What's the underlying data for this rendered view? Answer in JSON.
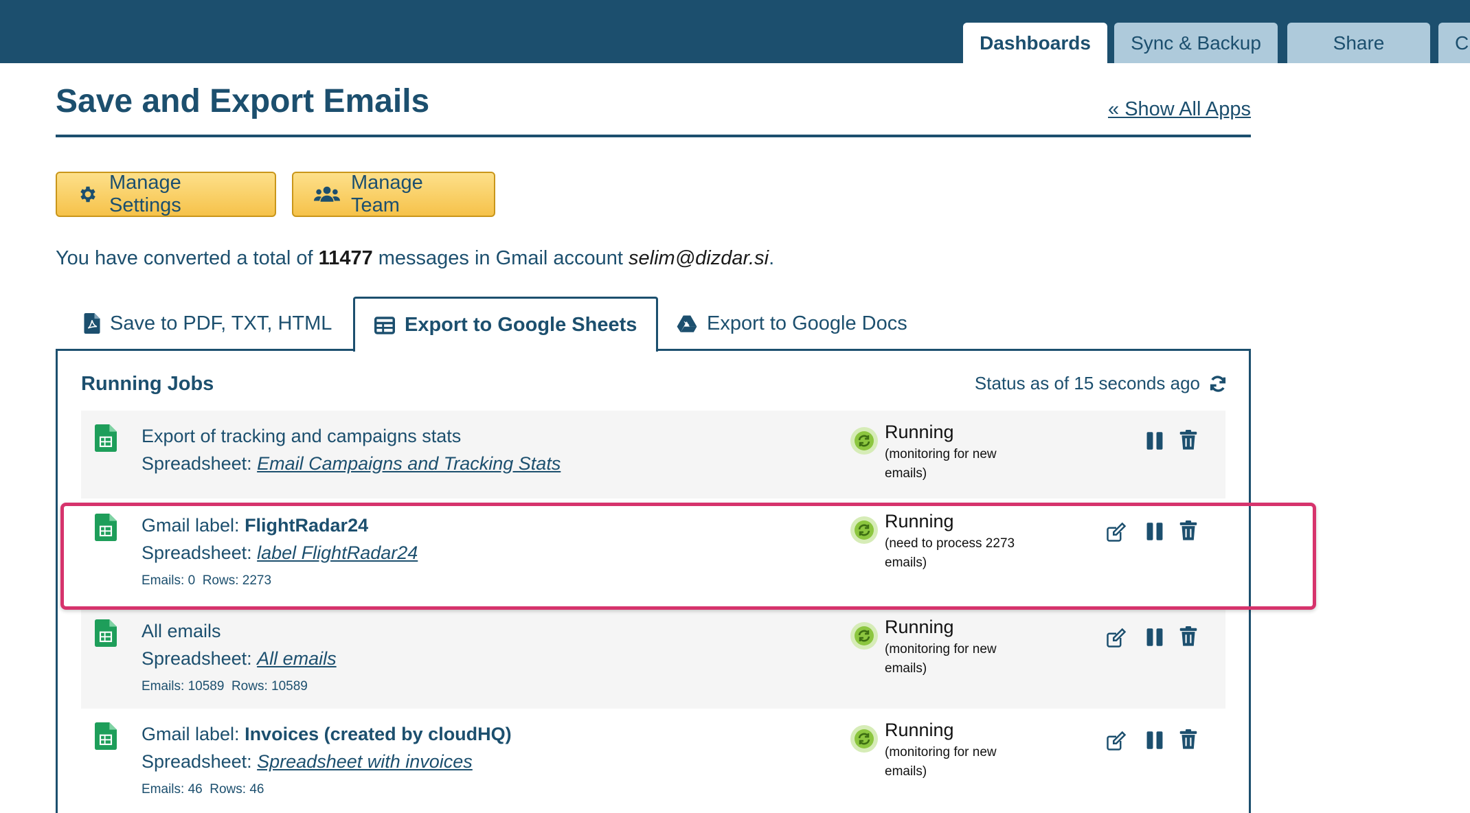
{
  "nav": {
    "tabs": [
      {
        "label": "Dashboards",
        "active": true
      },
      {
        "label": "Sync & Backup",
        "active": false
      },
      {
        "label": "Share",
        "active": false
      },
      {
        "label": "Cl",
        "active": false
      }
    ]
  },
  "header": {
    "title": "Save and Export Emails",
    "show_all_link": "« Show All Apps"
  },
  "buttons": {
    "manage_settings": "Manage Settings",
    "manage_team": "Manage Team"
  },
  "summary": {
    "prefix": "You have converted a total of ",
    "count": "11477",
    "middle": " messages in Gmail account ",
    "account": "selim@dizdar.si",
    "suffix": "."
  },
  "content_tabs": [
    {
      "label": "Save to PDF, TXT, HTML",
      "active": false
    },
    {
      "label": "Export to Google Sheets",
      "active": true
    },
    {
      "label": "Export to Google Docs",
      "active": false
    }
  ],
  "panel": {
    "title": "Running Jobs",
    "status_text": "Status as of 15 seconds ago"
  },
  "jobs": [
    {
      "name_prefix": "Export of tracking and campaigns stats",
      "name_bold": "",
      "sheet_prefix": "Spreadsheet: ",
      "sheet_link": "Email Campaigns and Tracking Stats",
      "counts": "",
      "state": "Running",
      "detail": "(monitoring for new emails)",
      "editable": false
    },
    {
      "name_prefix": "Gmail label: ",
      "name_bold": "FlightRadar24",
      "sheet_prefix": "Spreadsheet: ",
      "sheet_link": "label FlightRadar24",
      "counts": "Emails: 0  Rows: 2273",
      "state": "Running",
      "detail": "(need to process 2273 emails)",
      "editable": true
    },
    {
      "name_prefix": "All emails",
      "name_bold": "",
      "sheet_prefix": "Spreadsheet: ",
      "sheet_link": "All emails",
      "counts": "Emails: 10589  Rows: 10589",
      "state": "Running",
      "detail": "(monitoring for new emails)",
      "editable": true
    },
    {
      "name_prefix": "Gmail label: ",
      "name_bold": "Invoices (created by cloudHQ)",
      "sheet_prefix": "Spreadsheet: ",
      "sheet_link": "Spreadsheet with invoices",
      "counts": "Emails: 46  Rows: 46",
      "state": "Running",
      "detail": "(monitoring for new emails)",
      "editable": true
    }
  ],
  "colors": {
    "brand": "#1c4f6e",
    "button": "#f6c24a",
    "highlight": "#d6336c",
    "sheets_green": "#1e9e5a",
    "running_green": "#8cc63f"
  },
  "icons": {
    "settings": "gear-icon",
    "team": "users-icon",
    "pdf": "pdf-file-icon",
    "sheets": "table-icon",
    "docs": "drive-icon",
    "refresh": "refresh-icon",
    "edit": "edit-icon",
    "pause": "pause-icon",
    "delete": "trash-icon"
  }
}
